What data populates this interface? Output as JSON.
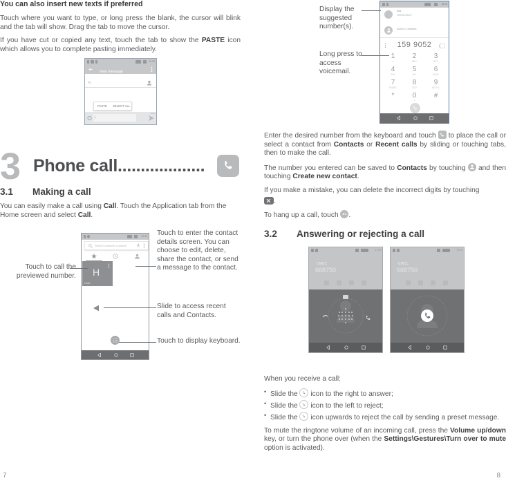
{
  "left_column": {
    "heading": "You can also insert new texts if preferred",
    "para1": "Touch where you want to type, or long press the blank, the cursor will blink and the tab will show. Drag the tab to move the cursor.",
    "para2_a": "If you have cut or copied any text, touch the tab to show the ",
    "para2_bold": "PASTE",
    "para2_b": " icon which allows you to complete pasting immediately.",
    "chapter": {
      "number": "3",
      "title": "Phone call...................",
      "icon": "phone-icon"
    },
    "section_31": {
      "num": "3.1",
      "title": "Making a call",
      "para_a": "You can easily make a call using ",
      "para_bold1": "Call",
      "para_b": ". Touch the Application tab from the Home screen and select ",
      "para_bold2": "Call",
      "para_c": "."
    },
    "callouts": {
      "call_previewed": "Touch to call the previewed number.",
      "contact_details": "Touch to enter the contact details screen. You can choose to edit, delete, share the contact, or send a message to the contact.",
      "slide_recent": "Slide to access recent calls and Contacts.",
      "display_keyboard": "Touch to display keyboard."
    },
    "page_number": "7"
  },
  "figures": {
    "new_message": {
      "title": "New message",
      "to_label": "To",
      "paste_button": "PASTE",
      "select_all_button": "SELECT ALL",
      "status_time": "11:35",
      "icons": [
        "back-arrow-icon",
        "overflow-menu-icon",
        "add-contact-icon",
        "emoji-icon",
        "send-icon"
      ]
    },
    "call_screen": {
      "search_placeholder": "Search contacts or places",
      "contact_initial": "H",
      "contact_name": "Hotel",
      "status_time": "10:44",
      "tabs": [
        "favorites-star-icon",
        "recent-clock-icon",
        "contacts-icon"
      ],
      "icons": [
        "search-icon",
        "mic-icon",
        "overflow-menu-icon",
        "dialpad-icon"
      ]
    },
    "dialer": {
      "suggested_name": "bird",
      "suggested_number": "18990033327",
      "add_to_contacts": "Add to Contacts",
      "entered_number": "159 9052",
      "status_time": "18:28",
      "keys": [
        {
          "digit": "1",
          "sub": "∞"
        },
        {
          "digit": "2",
          "sub": "ABC"
        },
        {
          "digit": "3",
          "sub": "DEF"
        },
        {
          "digit": "4",
          "sub": "GHI"
        },
        {
          "digit": "5",
          "sub": "JKL"
        },
        {
          "digit": "6",
          "sub": "MNO"
        },
        {
          "digit": "7",
          "sub": "PQRS"
        },
        {
          "digit": "8",
          "sub": "TUV"
        },
        {
          "digit": "9",
          "sub": "WXYZ"
        },
        {
          "digit": "*",
          "sub": ""
        },
        {
          "digit": "0",
          "sub": "+"
        },
        {
          "digit": "#",
          "sub": ""
        }
      ],
      "icons": [
        "overflow-menu-icon",
        "backspace-icon",
        "call-button-icon"
      ]
    },
    "incoming_call_1": {
      "carrier": "CMCC",
      "number": "668750",
      "status_time": "17:04"
    },
    "incoming_call_2": {
      "carrier": "CMCC",
      "number": "668750",
      "status_time": "17:04"
    }
  },
  "right_column": {
    "callouts": {
      "suggested_numbers": "Display the suggested number(s).",
      "voicemail": "Long press to access voicemail."
    },
    "para1_a": "Enter the desired number from the keyboard and touch ",
    "para1_b": " to place the call or select a contact from ",
    "para1_bold1": "Contacts",
    "para1_c": " or ",
    "para1_bold2": "Recent calls",
    "para1_d": " by sliding or touching tabs, then to make the call.",
    "para2_a": "The number you entered can be saved to ",
    "para2_bold1": "Contacts",
    "para2_b": " by touching ",
    "para2_c": " and then touching ",
    "para2_bold2": "Create new contact",
    "para2_d": ".",
    "para3": "If you make a mistake, you can delete the incorrect digits by touching",
    "para3_tail": ".",
    "para4_a": "To hang up a call, touch ",
    "para4_b": ".",
    "section_32": {
      "num": "3.2",
      "title": "Answering or rejecting a call"
    },
    "when_receive": "When you receive a call:",
    "bullets": [
      {
        "a": "Slide the ",
        "b": " icon to the right to answer;"
      },
      {
        "a": "Slide the ",
        "b": " icon to the left to reject;"
      },
      {
        "a": "Slide the ",
        "b": " icon upwards to reject the call by sending a preset message."
      }
    ],
    "para5_a": "To mute the ringtone volume of an incoming call, press the ",
    "para5_bold1": "Volume up/down",
    "para5_b": " key, or turn the phone over (when the ",
    "para5_bold2": "Settings\\Gestures\\Turn over to mute",
    "para5_c": " option is activated).",
    "page_number": "8"
  }
}
